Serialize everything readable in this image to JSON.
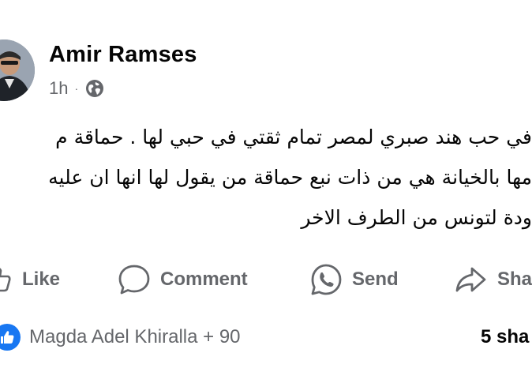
{
  "post": {
    "author": "Amir Ramses",
    "time": "1h",
    "separator": "·",
    "audience_icon": "globe-icon",
    "text_lines": [
      "في حب هند صبري لمصر تمام ثقتي في حبي لها . حماقة م",
      "مها بالخيانة هي من ذات نبع حماقة من يقول لها انها ان عليه",
      "ودة لتونس من الطرف الاخر"
    ]
  },
  "actions": {
    "like": "Like",
    "comment": "Comment",
    "send": "Send",
    "share": "Sha"
  },
  "reactions": {
    "icon": "thumbs-up-icon",
    "summary": "Magda Adel Khiralla + 90",
    "shares": "5 sha"
  },
  "colors": {
    "primary_text": "#050505",
    "secondary_text": "#65676b",
    "like_blue": "#1877f2",
    "background": "#ffffff"
  }
}
